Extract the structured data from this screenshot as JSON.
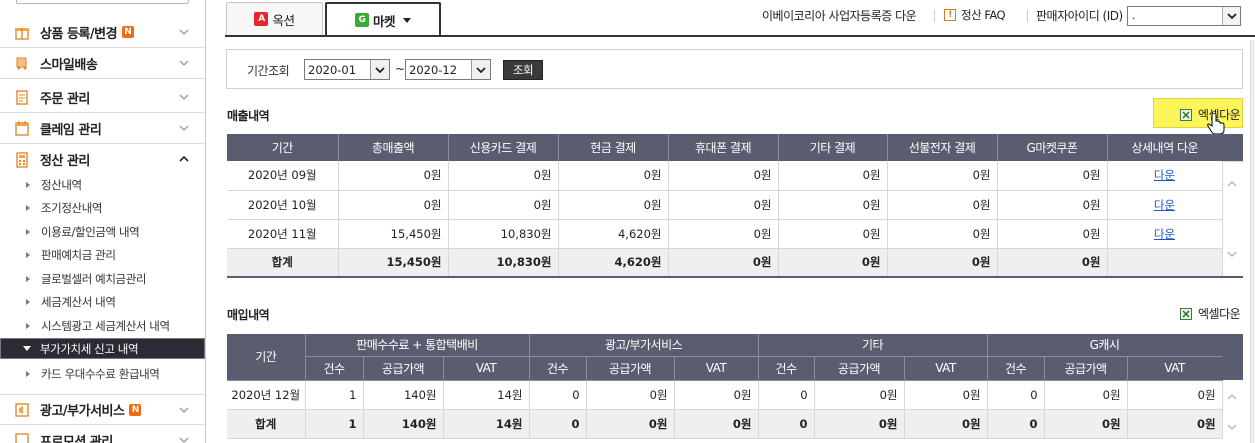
{
  "sidebar": {
    "menus": [
      {
        "label": "상품 등록/변경",
        "badge": "N",
        "icon": "gift-icon"
      },
      {
        "label": "스마일배송",
        "icon": "truck-icon"
      },
      {
        "label": "주문 관리",
        "icon": "clipboard-icon"
      },
      {
        "label": "클레임 관리",
        "icon": "calendar-icon"
      },
      {
        "label": "정산 관리",
        "icon": "calculator-icon",
        "expanded": true
      }
    ],
    "subitems": [
      "정산내역",
      "조기정산내역",
      "이용료/할인금액 내역",
      "판매예치금 관리",
      "글로벌셀러 예치금관리",
      "세금계산서 내역",
      "시스템광고 세금계산서 내역",
      "부가가치세 신고 내역",
      "카드 우대수수료 환급내역"
    ],
    "selected_subitem": "부가가치세 신고 내역",
    "menus_after": [
      {
        "label": "광고/부가서비스",
        "badge": "N",
        "icon": "megaphone-icon"
      },
      {
        "label": "프로모션 관리",
        "icon": "tag-icon"
      }
    ]
  },
  "tabs": [
    {
      "badge": "A",
      "label": "옥션",
      "color": "#e8242b",
      "active": false
    },
    {
      "badge": "G",
      "label": "마켓",
      "color": "#3aaa35",
      "active": true
    }
  ],
  "topbar": {
    "cert_download": "이베이코리아 사업자등록증 다운",
    "faq": "정산 FAQ",
    "seller_id_label": "판매자아이디 (ID)",
    "seller_id_value": "."
  },
  "filter": {
    "label": "기간조회",
    "from": "2020-01",
    "tilde": "~",
    "to": "2020-12",
    "query_button": "조회"
  },
  "sales": {
    "title": "매출내역",
    "excel_label": "엑셀다운",
    "headers": [
      "기간",
      "총매출액",
      "신용카드 결제",
      "현금 결제",
      "휴대폰 결제",
      "기타 결제",
      "선불전자 결제",
      "G마켓쿠폰",
      "상세내역 다운"
    ],
    "rows": [
      [
        "2020년 09월",
        "0원",
        "0원",
        "0원",
        "0원",
        "0원",
        "0원",
        "0원",
        "다운"
      ],
      [
        "2020년 10월",
        "0원",
        "0원",
        "0원",
        "0원",
        "0원",
        "0원",
        "0원",
        "다운"
      ],
      [
        "2020년 11월",
        "15,450원",
        "10,830원",
        "4,620원",
        "0원",
        "0원",
        "0원",
        "0원",
        "다운"
      ]
    ],
    "total": [
      "합계",
      "15,450원",
      "10,830원",
      "4,620원",
      "0원",
      "0원",
      "0원",
      "0원",
      ""
    ]
  },
  "purchase": {
    "title": "매입내역",
    "excel_label": "엑셀다운",
    "period_header": "기간",
    "groups": [
      "판매수수료 + 통합택배비",
      "광고/부가서비스",
      "기타",
      "G캐시"
    ],
    "subheaders": [
      "건수",
      "공급가액",
      "VAT"
    ],
    "rows": [
      [
        "2020년 12월",
        "1",
        "140원",
        "14원",
        "0",
        "0원",
        "0원",
        "0",
        "0원",
        "0원",
        "0",
        "0원",
        "0원"
      ]
    ],
    "total": [
      "합계",
      "1",
      "140원",
      "14원",
      "0",
      "0원",
      "0원",
      "0",
      "0원",
      "0원",
      "0",
      "0원",
      "0원"
    ]
  }
}
